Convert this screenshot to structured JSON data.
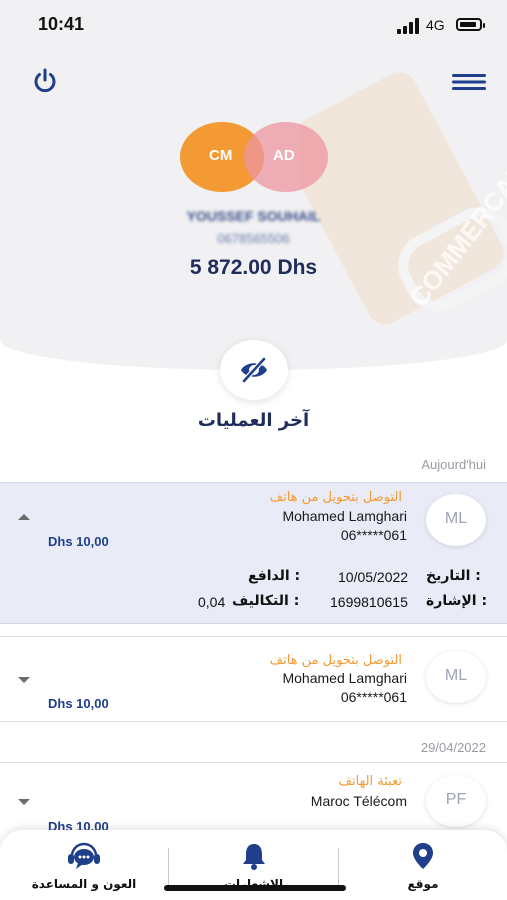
{
  "status_bar": {
    "time": "10:41",
    "network": "4G"
  },
  "watermark_text": "COMMERCANT",
  "header": {
    "avatars": [
      {
        "initials": "CM"
      },
      {
        "initials": "AD"
      }
    ],
    "user_name": "YOUSSEF SOUHAIL",
    "user_phone": "0678565506",
    "balance": "5 872.00 Dhs"
  },
  "section_title": "آخر العمليات",
  "groups": [
    {
      "date": "Aujourd'hui",
      "transactions": [
        {
          "initials": "ML",
          "type": "التوصل بتحويل من هاتف",
          "name": "Mohamed Lamghari",
          "phone": "06*****061",
          "amount": "Dhs 10,00",
          "expanded": true,
          "details": {
            "date_label": "التاريخ :",
            "date_value": "10/05/2022",
            "payer_label": "الدافع :",
            "payer_value": "",
            "reference_label": "الإشارة :",
            "reference_value": "1699810615",
            "fees_label": "التكاليف :",
            "fees_value": "0,04"
          }
        },
        {
          "initials": "ML",
          "type": "التوصل بتحويل من هاتف",
          "name": "Mohamed Lamghari",
          "phone": "06*****061",
          "amount": "Dhs 10,00",
          "expanded": false
        }
      ]
    },
    {
      "date": "29/04/2022",
      "transactions": [
        {
          "initials": "PF",
          "type": "تعبئة الهاتف",
          "name": "Maroc Télécom",
          "amount": "Dhs 10,00",
          "expanded": false
        }
      ]
    }
  ],
  "tab_bar": {
    "tabs": [
      {
        "label": "العون و المساعدة",
        "icon": "support-chat-icon"
      },
      {
        "label": "الإشعارات",
        "icon": "bell-icon"
      },
      {
        "label": "موقع",
        "icon": "location-pin-icon"
      }
    ]
  },
  "colors": {
    "primary": "#1f2c5c",
    "accent": "#f39a34",
    "amount_blue": "#1f3f8c"
  }
}
